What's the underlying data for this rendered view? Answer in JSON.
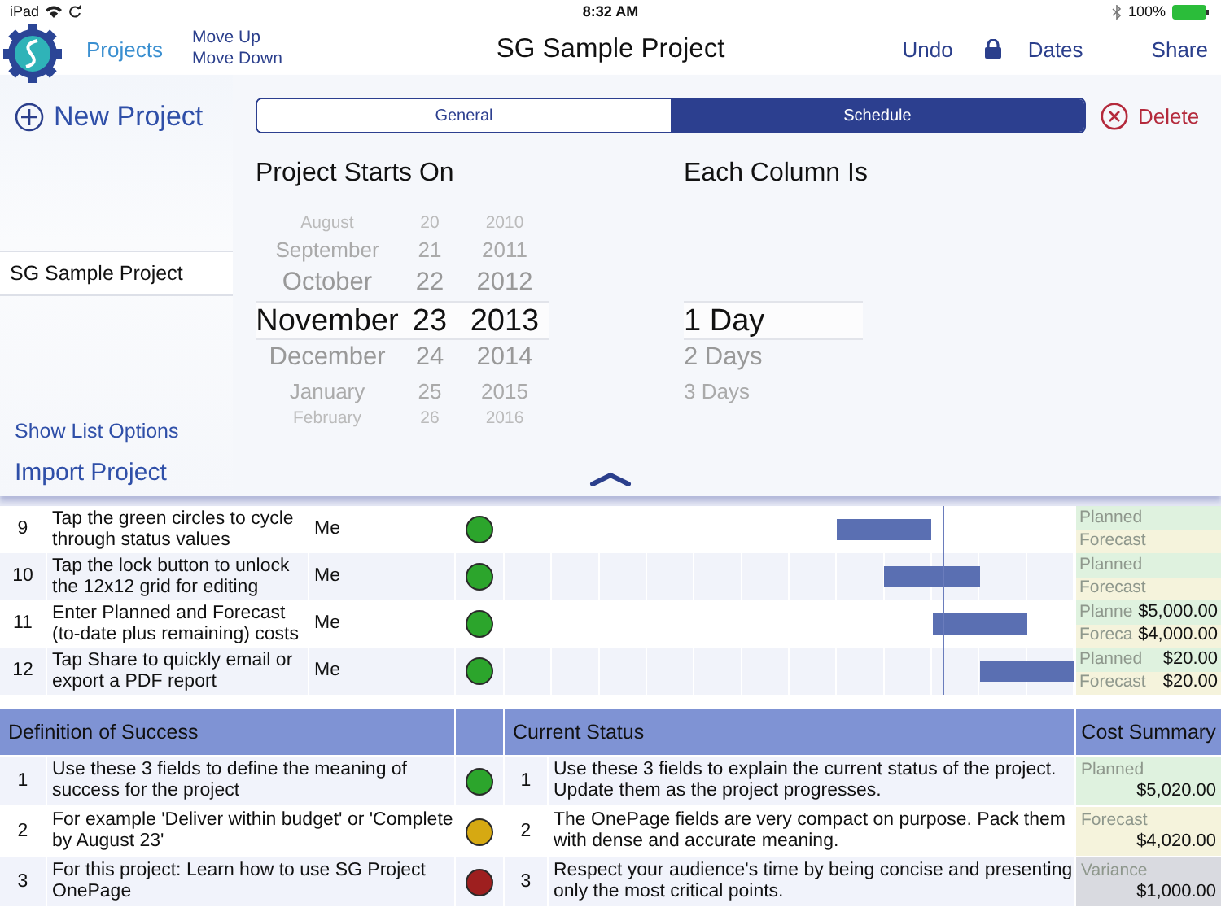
{
  "status_bar": {
    "device": "iPad",
    "time": "8:32 AM",
    "battery": "100%"
  },
  "nav": {
    "projects": "Projects",
    "move_up": "Move Up",
    "move_down": "Move Down",
    "title": "SG Sample Project",
    "undo": "Undo",
    "dates": "Dates",
    "share": "Share"
  },
  "project_list": {
    "new_project": "New Project",
    "items": [
      {
        "name": "SG Sample Project",
        "selected": false
      }
    ],
    "show_list_options": "Show List Options",
    "import_project": "Import Project"
  },
  "tabs": [
    {
      "label": "General",
      "selected": false
    },
    {
      "label": "Schedule",
      "selected": true
    }
  ],
  "delete": "Delete",
  "start_picker": {
    "heading": "Project Starts On",
    "months": [
      {
        "label": "August",
        "selected": false
      },
      {
        "label": "September",
        "selected": false
      },
      {
        "label": "October",
        "selected": false
      },
      {
        "label": "November",
        "selected": true
      },
      {
        "label": "December",
        "selected": false
      },
      {
        "label": "January",
        "selected": false
      },
      {
        "label": "February",
        "selected": false
      }
    ],
    "days": [
      {
        "label": "20",
        "selected": false
      },
      {
        "label": "21",
        "selected": false
      },
      {
        "label": "22",
        "selected": false
      },
      {
        "label": "23",
        "selected": true
      },
      {
        "label": "24",
        "selected": false
      },
      {
        "label": "25",
        "selected": false
      },
      {
        "label": "26",
        "selected": false
      }
    ],
    "years": [
      {
        "label": "2010",
        "selected": false
      },
      {
        "label": "2011",
        "selected": false
      },
      {
        "label": "2012",
        "selected": false
      },
      {
        "label": "2013",
        "selected": true
      },
      {
        "label": "2014",
        "selected": false
      },
      {
        "label": "2015",
        "selected": false
      },
      {
        "label": "2016",
        "selected": false
      }
    ]
  },
  "column_picker": {
    "heading": "Each Column Is",
    "options": [
      {
        "label": "1 Day",
        "selected": true
      },
      {
        "label": "2 Days",
        "selected": false
      },
      {
        "label": "3 Days",
        "selected": false
      }
    ]
  },
  "gantt_rows": [
    {
      "number": "9",
      "task": "Tap the green circles to cycle through status values",
      "owner": "Me",
      "color": "#2ca52c",
      "planned_label": "Planned",
      "forecast_label": "Forecast"
    },
    {
      "number": "10",
      "task": "Tap the lock button to unlock the 12x12 grid for editing",
      "owner": "Me",
      "color": "#2ca52c",
      "planned_label": "Planned",
      "forecast_label": "Forecast"
    },
    {
      "number": "11",
      "task": "Enter Planned and Forecast (to-date plus remaining) costs",
      "owner": "Me",
      "color": "#2ca52c",
      "planned_label": "Planne",
      "planned_value": "$5,000.00",
      "forecast_label": "Foreca",
      "forecast_value": "$4,000.00"
    },
    {
      "number": "12",
      "task": "Tap Share to quickly email or export a PDF report",
      "owner": "Me",
      "color": "#2ca52c",
      "planned_label": "Planned",
      "planned_value": "$20.00",
      "forecast_label": "Forecast",
      "forecast_value": "$20.00"
    }
  ],
  "success": {
    "heading": "Definition of Success",
    "rows": [
      {
        "number": "1",
        "text": "Use these 3 fields to define the meaning of success for the project",
        "color": "#2ca52c"
      },
      {
        "number": "2",
        "text": "For example 'Deliver within budget' or 'Complete by August 23'",
        "color": "#d6a912"
      },
      {
        "number": "3",
        "text": "For this project: Learn how to use SG Project OnePage",
        "color": "#9e1f1f"
      }
    ]
  },
  "status": {
    "heading": "Current Status",
    "rows": [
      {
        "number": "1",
        "text": "Use these 3 fields to explain the current status of the project. Update them as the project progresses."
      },
      {
        "number": "2",
        "text": "The OnePage fields are very compact on purpose.  Pack them with dense and accurate meaning."
      },
      {
        "number": "3",
        "text": "Respect your audience's time by being concise and presenting only the most critical points."
      }
    ]
  },
  "cost_summary": {
    "heading": "Cost Summary",
    "items": [
      {
        "kind": "planned",
        "label": "Planned",
        "value": "$5,020.00"
      },
      {
        "kind": "forecast",
        "label": "Forecast",
        "value": "$4,020.00"
      },
      {
        "kind": "variance",
        "label": "Variance",
        "value": "$1,000.00"
      }
    ]
  }
}
